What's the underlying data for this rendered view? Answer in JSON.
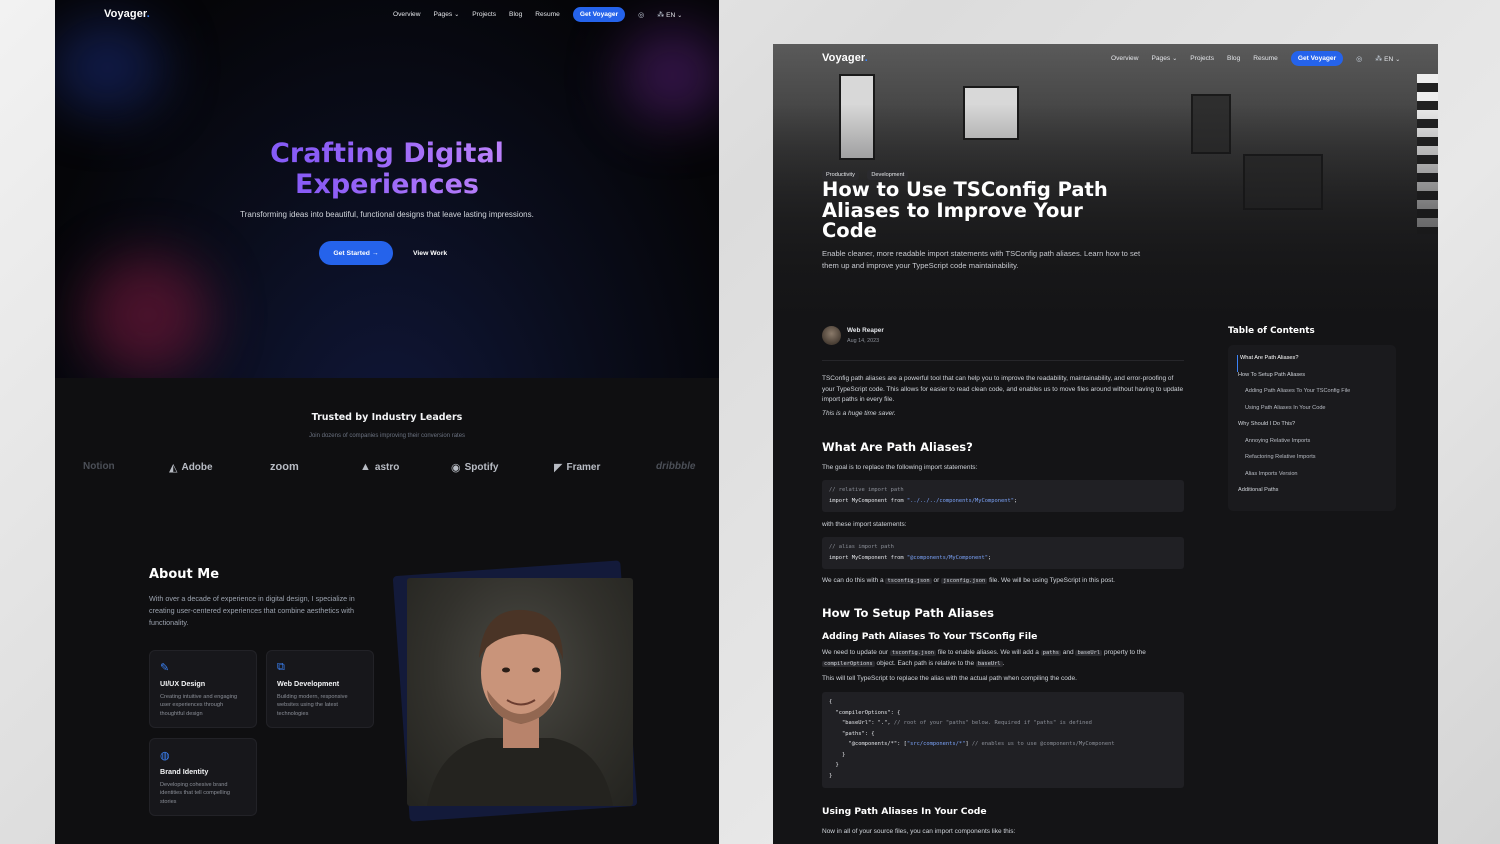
{
  "left": {
    "nav": {
      "brand": "Voyager",
      "links": [
        "Overview",
        "Pages",
        "Projects",
        "Blog",
        "Resume"
      ],
      "cta": "Get Voyager",
      "lang": "EN"
    },
    "hero": {
      "title_line1": "Crafting Digital",
      "title_line2": "Experiences",
      "subtitle": "Transforming ideas into beautiful, functional designs that leave lasting impressions.",
      "primary_btn": "Get Started",
      "secondary_btn": "View Work"
    },
    "trusted": {
      "title": "Trusted by Industry Leaders",
      "subtitle": "Join dozens of companies improving their conversion rates",
      "logos": [
        "Notion",
        "Adobe",
        "zoom",
        "astro",
        "Spotify",
        "Framer",
        "dribbble"
      ]
    },
    "about": {
      "title": "About Me",
      "text": "With over a decade of experience in digital design, I specialize in creating user-centered experiences that combine aesthetics with functionality.",
      "cards": [
        {
          "title": "UI/UX Design",
          "desc": "Creating intuitive and engaging user experiences through thoughtful design"
        },
        {
          "title": "Web Development",
          "desc": "Building modern, responsive websites using the latest technologies"
        },
        {
          "title": "Brand Identity",
          "desc": "Developing cohesive brand identities that tell compelling stories"
        }
      ]
    }
  },
  "right": {
    "nav": {
      "brand": "Voyager",
      "links": [
        "Overview",
        "Pages",
        "Projects",
        "Blog",
        "Resume"
      ],
      "cta": "Get Voyager",
      "lang": "EN"
    },
    "article": {
      "tags": [
        "Productivity",
        "Development"
      ],
      "title": "How to Use TSConfig Path Aliases to Improve Your Code",
      "description": "Enable cleaner, more readable import statements with TSConfig path aliases. Learn how to set them up and improve your TypeScript code maintainability.",
      "author": "Web Reaper",
      "date": "Aug 14, 2023",
      "intro": "TSConfig path aliases are a powerful tool that can help you to improve the readability, maintainability, and error-proofing of your TypeScript code. This allows for easier to read clean code, and enables us to move files around without having to update import paths in every file.",
      "intro_note": "This is a huge time saver.",
      "h_what": "What Are Path Aliases?",
      "goal": "The goal is to replace the following import statements:",
      "code1_comment": "// relative import path",
      "code1_line_start": "import MyComponent from ",
      "code1_path": "\"../../../components/MyComponent\"",
      "with_these": "with these import statements:",
      "code2_comment": "// alias import path",
      "code2_line_start": "import MyComponent from ",
      "code2_path": "\"@components/MyComponent\"",
      "cando_a": "We can do this with a",
      "cando_file1": "tsconfig.json",
      "cando_or": "or",
      "cando_file2": "jsconfig.json",
      "cando_b": "file. We will be using TypeScript in this post.",
      "h_setup": "How To Setup Path Aliases",
      "h_adding": "Adding Path Aliases To Your TSConfig File",
      "update_a": "We need to update our",
      "update_file": "tsconfig.json",
      "update_b": "file to enable aliases. We will add a",
      "update_paths": "paths",
      "update_and": "and",
      "update_baseurl": "baseUrl",
      "update_c": "property to the",
      "update_co": "compilerOptions",
      "update_d": "object. Each path is relative to the",
      "update_baseurl2": "baseUrl",
      "update_e": ".",
      "tell": "This will tell TypeScript to replace the alias with the actual path when compiling the code.",
      "code3_l1": "{",
      "code3_l2": "  \"compilerOptions\": {",
      "code3_l3": "    \"baseUrl\": \".\", ",
      "code3_l3c": "// root of your \"paths\" below. Required if \"paths\" is defined",
      "code3_l4": "    \"paths\": {",
      "code3_l5a": "      \"@components/*\": [",
      "code3_l5s": "\"src/components/*\"",
      "code3_l5b": "] ",
      "code3_l5c": "// enables us to use @components/MyComponent",
      "code3_l6": "    }",
      "code3_l7": "  }",
      "code3_l8": "}",
      "h_using": "Using Path Aliases In Your Code",
      "now": "Now in all of your source files, you can import components like this:"
    },
    "toc": {
      "title": "Table of Contents",
      "items": [
        {
          "label": "What Are Path Aliases?",
          "level": 1
        },
        {
          "label": "How To Setup Path Aliases",
          "level": 1
        },
        {
          "label": "Adding Path Aliases To Your TSConfig File",
          "level": 2
        },
        {
          "label": "Using Path Aliases In Your Code",
          "level": 2
        },
        {
          "label": "Why Should I Do This?",
          "level": 1
        },
        {
          "label": "Annoying Relative Imports",
          "level": 2
        },
        {
          "label": "Refactoring Relative Imports",
          "level": 2
        },
        {
          "label": "Alias Imports Version",
          "level": 2
        },
        {
          "label": "Additional Paths",
          "level": 1
        }
      ]
    }
  },
  "colors": {
    "accent": "#2563eb",
    "link": "#3b82f6",
    "bg_dark": "#0f0f11"
  }
}
